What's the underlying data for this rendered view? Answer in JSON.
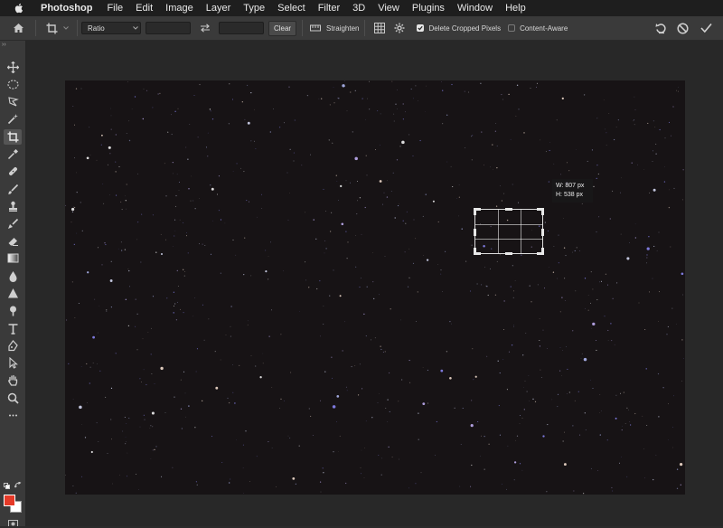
{
  "menubar": {
    "app_name": "Photoshop",
    "items": [
      "File",
      "Edit",
      "Image",
      "Layer",
      "Type",
      "Select",
      "Filter",
      "3D",
      "View",
      "Plugins",
      "Window",
      "Help"
    ]
  },
  "options_bar": {
    "ratio_select": "Ratio",
    "width_value": "",
    "height_value": "",
    "clear_label": "Clear",
    "straighten_label": "Straighten",
    "delete_cropped_label": "Delete Cropped Pixels",
    "delete_cropped_checked": true,
    "content_aware_label": "Content-Aware",
    "content_aware_checked": false
  },
  "toolbar": {
    "collapse_glyph": "››",
    "tools": [
      "move-icon",
      "marquee-icon",
      "lasso-icon",
      "magic-wand-icon",
      "crop-icon",
      "eyedropper-icon",
      "healing-brush-icon",
      "brush-icon",
      "clone-stamp-icon",
      "history-brush-icon",
      "eraser-icon",
      "gradient-icon",
      "blur-icon",
      "dodge-icon",
      "pen-icon",
      "type-icon",
      "path-selection-icon",
      "hand-icon",
      "zoom-icon",
      "more-icon"
    ],
    "active_tool": "crop-icon",
    "foreground_color": "#e53a28",
    "background_color": "#ffffff"
  },
  "canvas": {
    "crop_width": "W: 807 px",
    "crop_height": "H: 538 px",
    "background_color": "#171315"
  }
}
